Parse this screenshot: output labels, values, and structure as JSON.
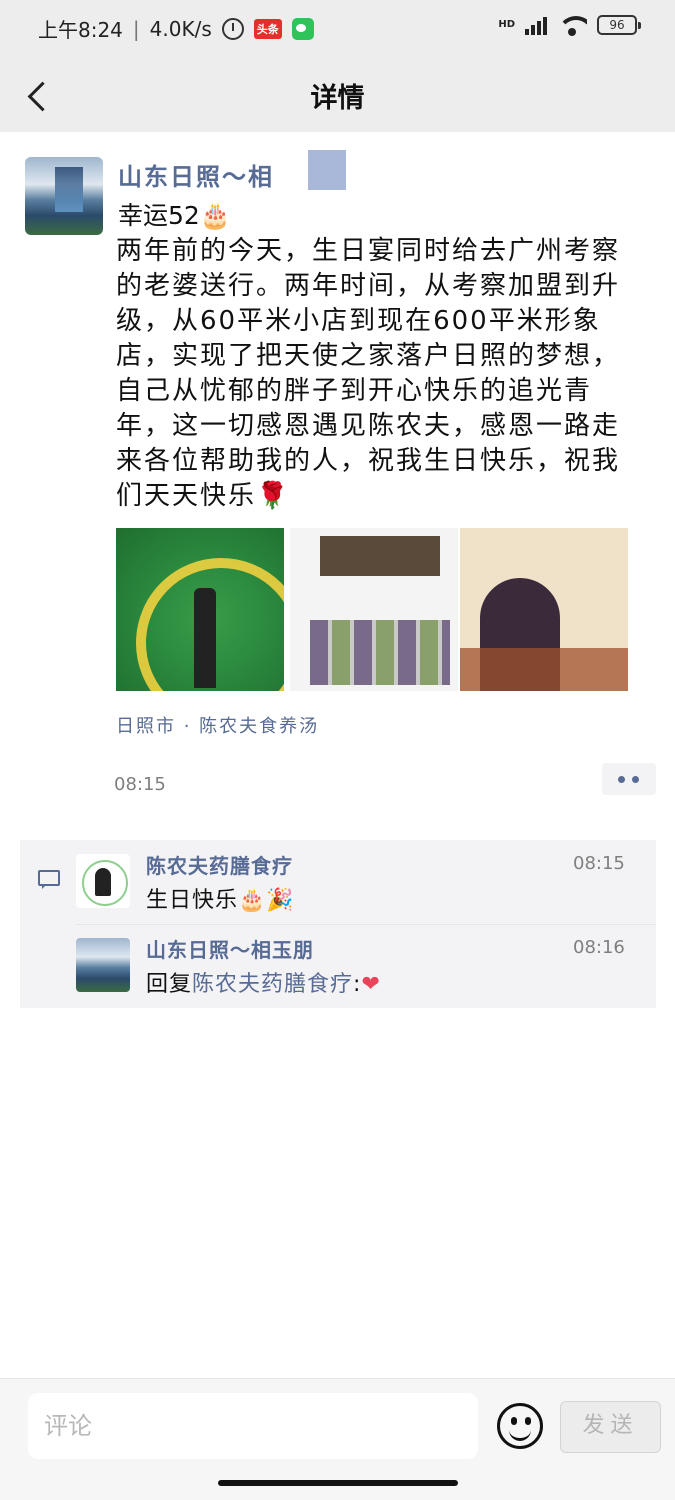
{
  "status_bar": {
    "time": "上午8:24",
    "network_speed": "4.0K/s",
    "headline_badge": "头条",
    "hd_label": "HD",
    "battery": "96"
  },
  "nav": {
    "title": "详情"
  },
  "post": {
    "author": "山东日照～相",
    "title": "幸运52🎂",
    "text": "两年前的今天，生日宴同时给去广州考察的老婆送行。两年时间，从考察加盟到升级，从60平米小店到现在600平米形象店，实现了把天使之家落户日照的梦想，自己从忧郁的胖子到开心快乐的追光青年，这一切感恩遇见陈农夫，感恩一路走来各位帮助我的人，祝我生日快乐，祝我们天天快乐🌹",
    "location": "日照市 · 陈农夫食养汤",
    "time": "08:15"
  },
  "comments": [
    {
      "author": "陈农夫药膳食疗",
      "time": "08:15",
      "text": "生日快乐🎂🎉"
    },
    {
      "author": "山东日照～相玉朋",
      "time": "08:16",
      "reply_prefix": "回复",
      "reply_to": "陈农夫药膳食疗",
      "reply_suffix": ":",
      "emoji": "❤"
    }
  ],
  "input_bar": {
    "placeholder": "评论",
    "send_label": "发送"
  }
}
